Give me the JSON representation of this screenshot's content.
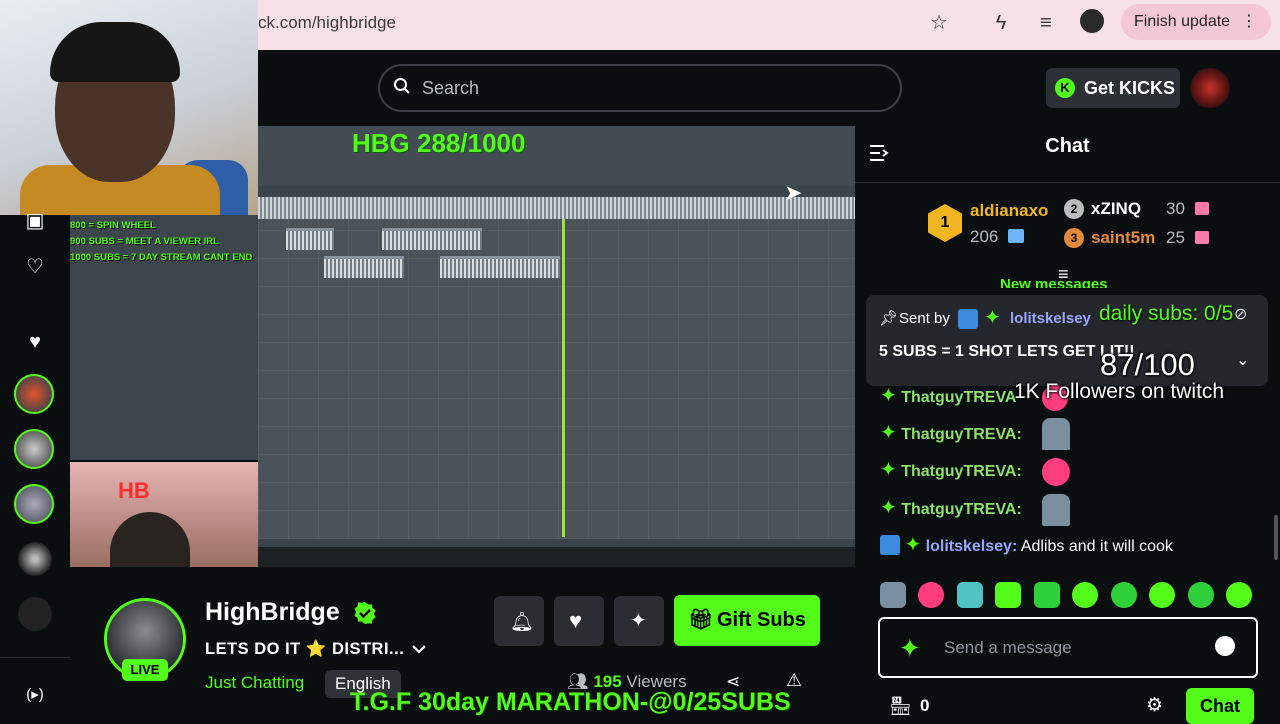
{
  "browser": {
    "url": "ck.com/highbridge",
    "finish_update": "Finish update",
    "icons": [
      "star-icon",
      "lightning-icon",
      "playlist-icon",
      "profile-icon",
      "kebab-menu-icon"
    ]
  },
  "header": {
    "search_placeholder": "Search",
    "kicks_label": "Get KICKS"
  },
  "stream_overlay": {
    "hbg_counter": "HBG 288/1000",
    "sub_goals": [
      "800 = SPIN WHEEL",
      "900 SUBS =  MEET A VIEWER IRL",
      "1000 SUBS = 7 DAY STREAM CANT END"
    ],
    "marathon": "T.G.F 30day MARATHON-@0/25SUBS"
  },
  "channel": {
    "name": "HighBridge",
    "title": "LETS DO IT ⭐ DISTRI...",
    "live": "LIVE",
    "category": "Just Chatting",
    "language": "English",
    "viewers_count": "195",
    "viewers_label": "Viewers",
    "gift_subs": "Gift Subs"
  },
  "chat": {
    "heading": "Chat",
    "leaderboard": [
      {
        "rank": "1",
        "name": "aldianaxo",
        "amount": "206"
      },
      {
        "rank": "2",
        "name": "xZINQ",
        "amount": "30"
      },
      {
        "rank": "3",
        "name": "saint5m",
        "amount": "25"
      }
    ],
    "new_messages": "New messages",
    "pinned": {
      "sent_by_label": "Sent by",
      "sender": "lolitskelsey",
      "message": "5 SUBS = 1 SHOT LETS GET LIT!!"
    },
    "overlay_daily_subs": "daily subs: 0/5",
    "overlay_progress": "87/100",
    "overlay_followers": "1K  Followers on twitch",
    "messages": [
      {
        "user": "ThatguyTREVA",
        "text": "",
        "emote": "red"
      },
      {
        "user": "ThatguyTREVA:",
        "text": "",
        "emote": "figure"
      },
      {
        "user": "ThatguyTREVA:",
        "text": "",
        "emote": "red"
      },
      {
        "user": "ThatguyTREVA:",
        "text": "",
        "emote": "figure"
      },
      {
        "user": "lolitskelsey:",
        "text": " Adlibs and it will cook",
        "emote": ""
      }
    ],
    "input_placeholder": "Send a message",
    "points": "0",
    "chat_button": "Chat"
  },
  "colors": {
    "brand_green": "#53fc18",
    "background": "#0b0e0f",
    "browser_bar": "#f7e1e6"
  }
}
